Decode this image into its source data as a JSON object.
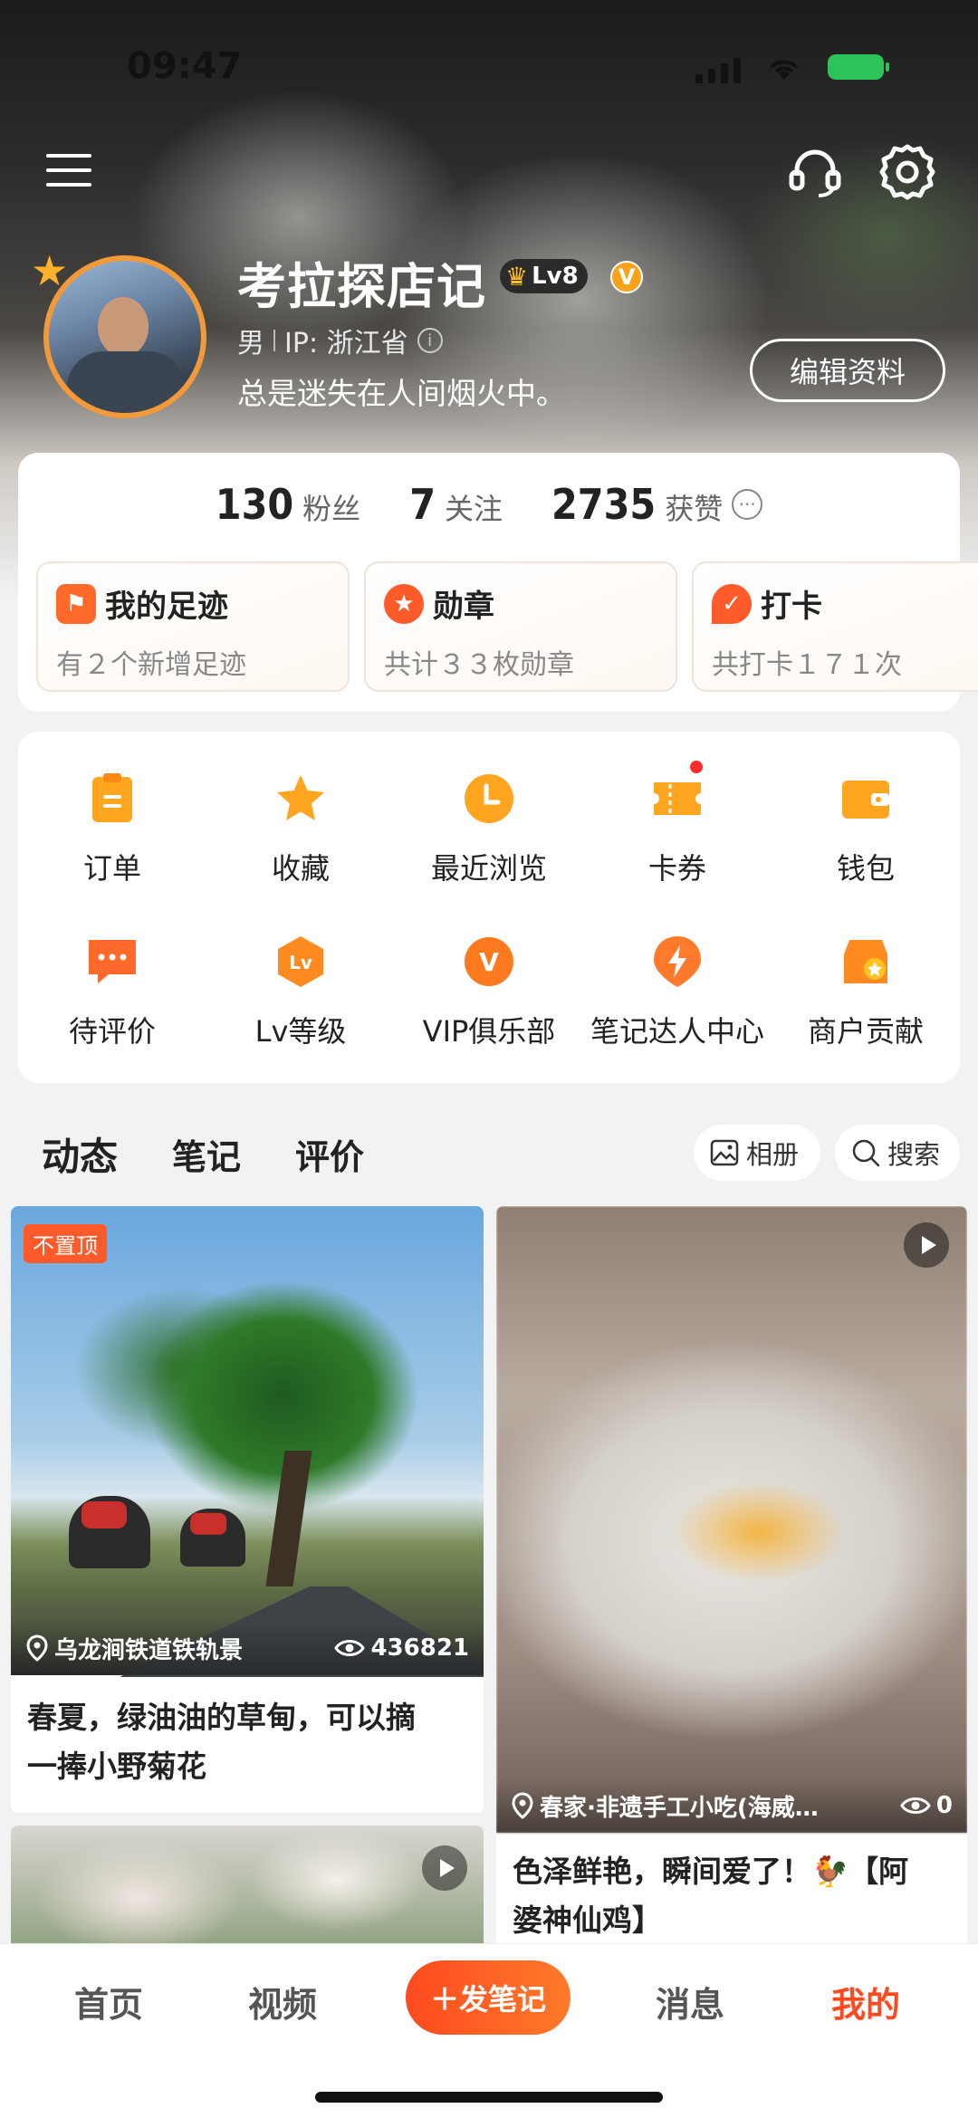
{
  "status_bar": {
    "time": "09:47"
  },
  "profile": {
    "name": "考拉探店记",
    "level": "Lv8",
    "verified_mark": "V",
    "gender": "男",
    "ip": "IP: 浙江省",
    "bio": "总是迷失在人间烟火中。",
    "edit_label": "编辑资料"
  },
  "stats": [
    {
      "value": "130",
      "label": "粉丝"
    },
    {
      "value": "7",
      "label": "关注"
    },
    {
      "value": "2735",
      "label": "获赞"
    }
  ],
  "features": [
    {
      "title": "我的足迹",
      "sub": "有２个新增足迹",
      "icon": "footprint-map-icon",
      "color": "#ff6a2a"
    },
    {
      "title": "勋章",
      "sub": "共计３３枚勋章",
      "icon": "medal-icon",
      "color": "#ff5a2a"
    },
    {
      "title": "打卡",
      "sub": "共打卡１７１次",
      "icon": "checkin-icon",
      "color": "#ff5a2a"
    }
  ],
  "shortcuts": [
    {
      "label": "订单",
      "icon": "order-clipboard-icon"
    },
    {
      "label": "收藏",
      "icon": "star-icon"
    },
    {
      "label": "最近浏览",
      "icon": "clock-icon"
    },
    {
      "label": "卡券",
      "icon": "coupon-icon"
    },
    {
      "label": "钱包",
      "icon": "wallet-icon"
    },
    {
      "label": "待评价",
      "icon": "comment-icon"
    },
    {
      "label": "Lv等级",
      "icon": "level-hexagon-icon",
      "glyph": "Lv"
    },
    {
      "label": "VIP俱乐部",
      "icon": "vip-icon",
      "glyph": "V"
    },
    {
      "label": "笔记达人中心",
      "icon": "lightning-icon"
    },
    {
      "label": "商户贡献",
      "icon": "shop-icon"
    }
  ],
  "tabs": [
    "动态",
    "笔记",
    "评价"
  ],
  "tab_actions": {
    "album": "相册",
    "search": "搜索"
  },
  "posts": [
    {
      "tag": "不置顶",
      "location": "乌龙涧铁道铁轨景",
      "views": "436821",
      "title_line1": "春夏，绿油油的草甸，可以摘",
      "title_line2": "一捧小野菊花"
    },
    {
      "location": "春家·非遗手工小吃(海威…",
      "views": "0",
      "title_line1": "色泽鲜艳，瞬间爱了！🐓【阿",
      "title_line2": "婆神仙鸡】"
    }
  ],
  "bottom_nav": {
    "home": "首页",
    "video": "视频",
    "publish": "＋发笔记",
    "messages": "消息",
    "me": "我的"
  },
  "colors": {
    "accent": "#ff4a1f",
    "icon_orange": "#ffa51f",
    "red_dot": "#ff2b2b"
  }
}
